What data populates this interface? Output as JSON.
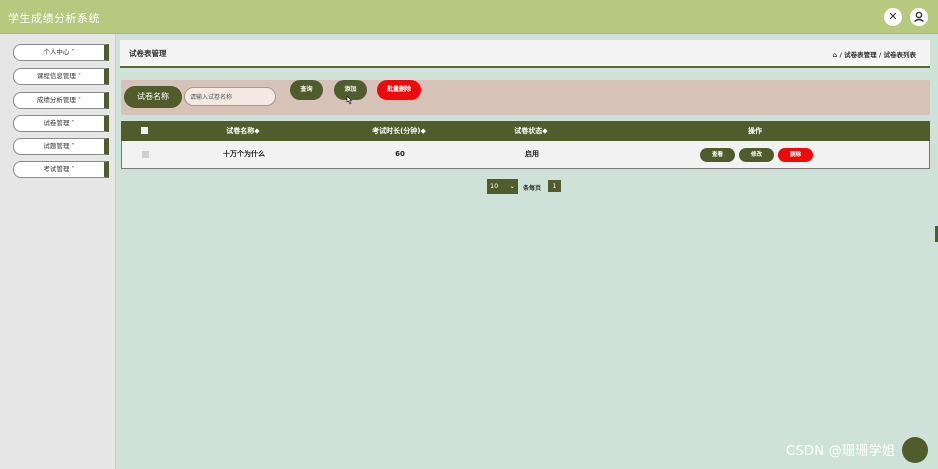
{
  "header": {
    "app_title": "学生成绩分析系统",
    "icons": [
      "close-circle-icon",
      "user-icon"
    ]
  },
  "sidebar": {
    "items": [
      {
        "label": "个人中心 ˅"
      },
      {
        "label": "课程信息管理 ˅"
      },
      {
        "label": "成绩分析管理 ˅"
      },
      {
        "label": "试卷管理 ˅"
      },
      {
        "label": "试题管理 ˅"
      },
      {
        "label": "考试管理 ˅"
      }
    ]
  },
  "content": {
    "title": "试卷表管理",
    "breadcrumb": "⌂ / 试卷表管理 / 试卷表列表"
  },
  "search": {
    "label": "试卷名称",
    "placeholder": "请输入试卷名称",
    "query_button": "查询",
    "add_button": "添加",
    "batch_delete_button": "批量删除"
  },
  "table": {
    "headers": [
      "试卷名称◆",
      "考试时长(分钟)◆",
      "试卷状态◆",
      "操作"
    ],
    "rows": [
      {
        "name": "十万个为什么",
        "duration": "60",
        "status": "启用"
      }
    ],
    "row_actions": {
      "view": "查看",
      "edit": "修改",
      "delete": "删除"
    }
  },
  "pagination": {
    "page_size": "10",
    "per_page_label": "条每页",
    "current_page": "1"
  },
  "watermark": "CSDN @珊珊学姐",
  "colors": {
    "topbar": "#b6c97f",
    "primary_dark": "#505c2b",
    "danger": "#ee0a0a",
    "search_bg": "#d7c2b8",
    "content_bg": "#cfe2d9"
  }
}
